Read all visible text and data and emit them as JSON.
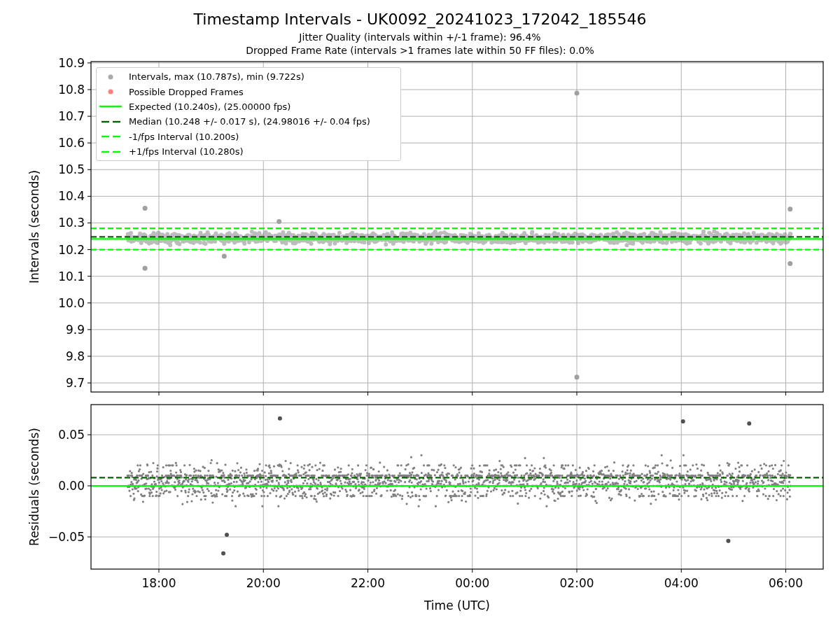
{
  "title": "Timestamp Intervals - UK0092_20241023_172042_185546",
  "subtitles": [
    "Jitter Quality (intervals within +/-1 frame): 96.4%",
    "Dropped Frame Rate (intervals >1 frames late within 50 FF files): 0.0%"
  ],
  "intervals_panel": {
    "legend": [
      {
        "label": "Intervals, max (10.787s), min (9.722s)",
        "kind": "marker",
        "color": "#aaaaaa"
      },
      {
        "label": "Possible Dropped Frames",
        "kind": "marker",
        "color": "#ff7f7f"
      },
      {
        "label": "Expected (10.240s), (25.00000 fps)",
        "kind": "line",
        "color": "#00ff00"
      },
      {
        "label": "Median (10.248 +/- 0.017 s), (24.98016 +/- 0.04 fps)",
        "kind": "dashed",
        "color": "#006400"
      },
      {
        "label": "-1/fps Interval (10.200s)",
        "kind": "dashed",
        "color": "#00ff00"
      },
      {
        "label": "+1/fps Interval (10.280s)",
        "kind": "dashed",
        "color": "#00ff00"
      }
    ],
    "chart_data": {
      "type": "scatter",
      "ylabel": "Intervals (seconds)",
      "grid": true,
      "xlim": [
        "2024-10-23T16:42",
        "2024-10-24T06:43"
      ],
      "ylim": [
        9.666,
        10.905
      ],
      "yticks": [
        {
          "value": 9.7,
          "label": "9.7"
        },
        {
          "value": 9.8,
          "label": "9.8"
        },
        {
          "value": 9.9,
          "label": "9.9"
        },
        {
          "value": 10.0,
          "label": "10.0"
        },
        {
          "value": 10.1,
          "label": "10.1"
        },
        {
          "value": 10.2,
          "label": "10.2"
        },
        {
          "value": 10.3,
          "label": "10.3"
        },
        {
          "value": 10.4,
          "label": "10.4"
        },
        {
          "value": 10.5,
          "label": "10.5"
        },
        {
          "value": 10.6,
          "label": "10.6"
        },
        {
          "value": 10.7,
          "label": "10.7"
        },
        {
          "value": 10.8,
          "label": "10.8"
        },
        {
          "value": 10.9,
          "label": "10.9"
        }
      ],
      "series": [
        {
          "color": "#a0a0a0",
          "x": [
            "2024-10-23T17:44",
            "2024-10-23T17:44",
            "2024-10-24T02:00",
            "2024-10-24T02:00",
            "2024-10-24T06:05",
            "2024-10-24T06:05",
            "2024-10-23T19:15",
            "2024-10-23T20:18"
          ],
          "values": [
            10.355,
            10.13,
            10.787,
            9.722,
            10.352,
            10.148,
            10.175,
            10.305
          ]
        }
      ],
      "ref_lines": [
        {
          "axis": "y",
          "value": 10.24,
          "color": "#00ff00"
        },
        {
          "axis": "y",
          "value": 10.248,
          "color": "#006400"
        },
        {
          "axis": "y",
          "value": 10.2,
          "color": "#00ff00"
        },
        {
          "axis": "y",
          "value": 10.28,
          "color": "#00ff00"
        }
      ]
    }
  },
  "residuals_panel": {
    "chart_data": {
      "type": "scatter",
      "xlabel": "Time (UTC)",
      "ylabel": "Residuals (seconds)",
      "grid": true,
      "xlim": [
        "2024-10-23T16:42",
        "2024-10-24T06:43"
      ],
      "ylim": [
        -0.0815,
        0.0795
      ],
      "xticks": [
        {
          "value": "2024-10-23T18:00",
          "label": "18:00"
        },
        {
          "value": "2024-10-23T20:00",
          "label": "20:00"
        },
        {
          "value": "2024-10-23T22:00",
          "label": "22:00"
        },
        {
          "value": "2024-10-24T00:00",
          "label": "00:00"
        },
        {
          "value": "2024-10-24T02:00",
          "label": "02:00"
        },
        {
          "value": "2024-10-24T04:00",
          "label": "04:00"
        },
        {
          "value": "2024-10-24T06:00",
          "label": "06:00"
        }
      ],
      "yticks": [
        {
          "value": -0.05,
          "label": "−0.05"
        },
        {
          "value": 0,
          "label": "0.00"
        },
        {
          "value": 0.05,
          "label": "0.05"
        }
      ],
      "series": [
        {
          "color": "#505050",
          "x": [
            "2024-10-23T19:14",
            "2024-10-23T20:19",
            "2024-10-24T04:02",
            "2024-10-24T05:18",
            "2024-10-24T04:54",
            "2024-10-23T19:18"
          ],
          "values": [
            -0.066,
            0.066,
            0.063,
            0.061,
            -0.054,
            -0.048
          ]
        }
      ],
      "ref_lines": [
        {
          "axis": "y",
          "value": 0,
          "color": "#00ff00"
        },
        {
          "axis": "y",
          "value": 0.008,
          "color": "#006400"
        }
      ]
    }
  }
}
